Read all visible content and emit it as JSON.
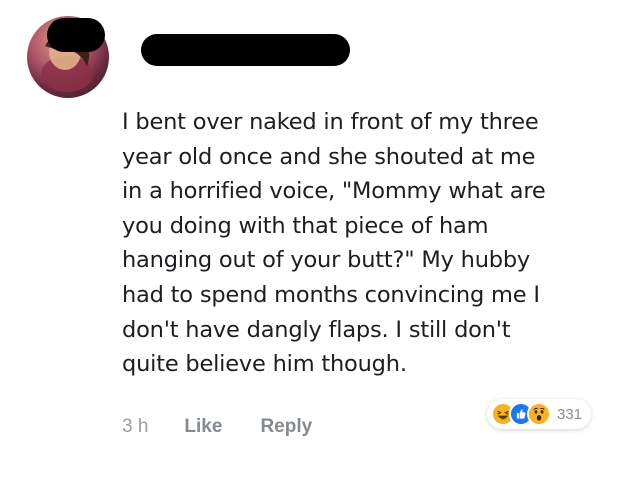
{
  "comment": {
    "lines": [
      "I bent over naked in front of my three",
      "year old once and she shouted at me",
      "in a horrified voice, \"Mommy what are",
      "you doing with that piece of ham",
      "hanging out of your butt?\"  My hubby",
      "had to spend months convincing me I",
      "don't have dangly flaps.  I still don't",
      "quite believe him though."
    ]
  },
  "actions": {
    "time": "3 h",
    "like_label": "Like",
    "reply_label": "Reply"
  },
  "reactions": {
    "icons": [
      "haha-icon",
      "like-icon",
      "wow-icon"
    ],
    "count": "331",
    "colors": {
      "haha": "#f7b125",
      "like": "#1877f2",
      "wow": "#f7b125"
    }
  }
}
